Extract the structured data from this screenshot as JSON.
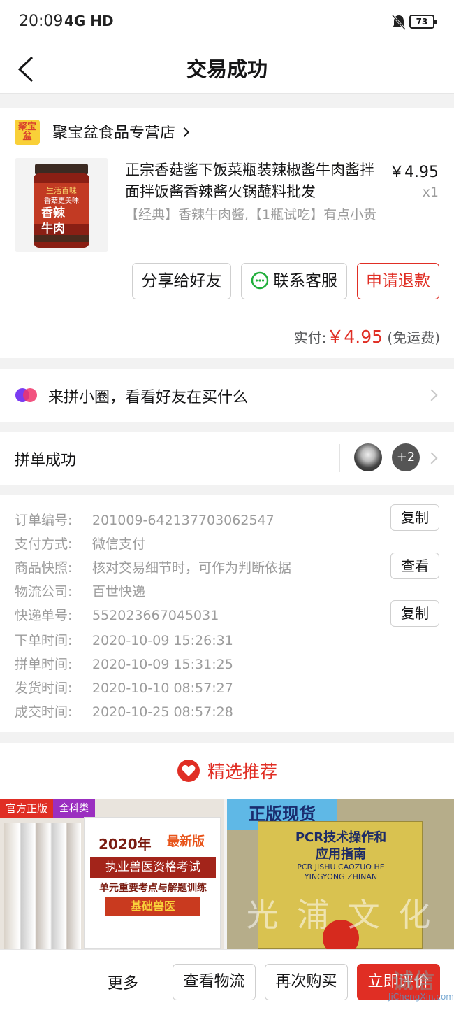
{
  "status_bar": {
    "time": "20:09",
    "network": "4G HD",
    "battery": "73"
  },
  "nav": {
    "title": "交易成功"
  },
  "shop": {
    "logo_text": "聚宝盆",
    "name": "聚宝盆食品专营店"
  },
  "product": {
    "title": "正宗香菇酱下饭菜瓶装辣椒酱牛肉酱拌面拌饭酱香辣酱火锅蘸料批发",
    "price": "￥4.95",
    "qty": "x1",
    "spec": "【经典】香辣牛肉酱,【1瓶试吃】有点小贵",
    "image_text": "生活百味 香菇更美味 香辣牛肉"
  },
  "actions": {
    "share": "分享给好友",
    "contact": "联系客服",
    "refund": "申请退款"
  },
  "payment": {
    "label": "实付:",
    "amount": "￥4.95",
    "note": "(免运费)"
  },
  "circle": {
    "text": "来拼小圈，看看好友在买什么"
  },
  "group": {
    "text": "拼单成功",
    "extra": "+2"
  },
  "order_info": [
    {
      "key": "订单编号:",
      "value": "201009-642137703062547",
      "button": "复制"
    },
    {
      "key": "支付方式:",
      "value": "微信支付",
      "button": ""
    },
    {
      "key": "商品快照:",
      "value": "核对交易细节时，可作为判断依据",
      "button": "查看"
    },
    {
      "key": "物流公司:",
      "value": "百世快递",
      "button": ""
    },
    {
      "key": "快递单号:",
      "value": "552023667045031",
      "button": "复制"
    },
    {
      "key": "下单时间:",
      "value": "2020-10-09 15:26:31",
      "button": ""
    },
    {
      "key": "拼单时间:",
      "value": "2020-10-09 15:31:25",
      "button": ""
    },
    {
      "key": "发货时间:",
      "value": "2020-10-10 08:57:27",
      "button": ""
    },
    {
      "key": "成交时间:",
      "value": "2020-10-25 08:57:28",
      "button": ""
    }
  ],
  "recommend": {
    "title": "精选推荐",
    "item1": {
      "tag1": "官方正版",
      "tag2": "全科类",
      "year": "2020年",
      "badge": "最新版",
      "line1": "执业兽医资格考试",
      "line2": "单元重要考点与解题训练",
      "line3": "基础兽医"
    },
    "item2": {
      "tag": "正版现货",
      "line1": "PCR技术操作和",
      "line2": "应用指南",
      "line3": "PCR JISHU CAOZUO HE",
      "line4": "YINGYONG ZHINAN",
      "watermark": "光 浦 文 化"
    }
  },
  "bottom_bar": {
    "more": "更多",
    "logistics": "查看物流",
    "rebuy": "再次购买",
    "review": "立即评价"
  },
  "watermark": {
    "brand": "诚信",
    "site": "JiChengXin.com"
  }
}
